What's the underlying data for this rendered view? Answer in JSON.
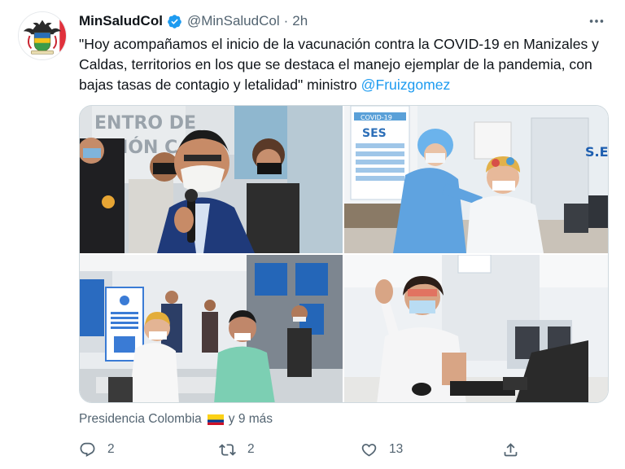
{
  "author": {
    "display_name": "MinSaludCol",
    "handle": "@MinSaludCol",
    "separator": "·",
    "time": "2h",
    "verified": true,
    "avatar_icon": "colombia-coat-of-arms-icon"
  },
  "more_icon": "more-horizontal-icon",
  "tweet": {
    "text": "\"Hoy acompañamos el inicio de la vacunación contra la COVID-19 en Manizales y Caldas, territorios en los que se destaca el manejo ejemplar de la pandemia, con bajas tasas de contagio y letalidad\" ministro ",
    "mention": "@Fruizgomez"
  },
  "media": {
    "photo1": {
      "sign_text": "CENTRO DE\nACIÓN C"
    },
    "photo2": {
      "poster_top": "COVID-19",
      "poster_title": "SES",
      "wall_text": "S.E"
    },
    "photo3": {
      "kiosk_text": "Entrega de información y firma de consentimiento informado"
    },
    "photo4": {}
  },
  "tagged": {
    "text": "Presidencia Colombia",
    "others": "y 9 más",
    "flag_icon": "colombia-flag-icon"
  },
  "actions": [
    {
      "name": "reply",
      "icon": "reply-icon",
      "count": "2"
    },
    {
      "name": "retweet",
      "icon": "retweet-icon",
      "count": "2"
    },
    {
      "name": "like",
      "icon": "heart-icon",
      "count": "13"
    },
    {
      "name": "share",
      "icon": "share-icon",
      "count": ""
    }
  ],
  "colors": {
    "link": "#1d9bf0",
    "secondary_text": "#536471",
    "verified": "#1d9bf0"
  }
}
